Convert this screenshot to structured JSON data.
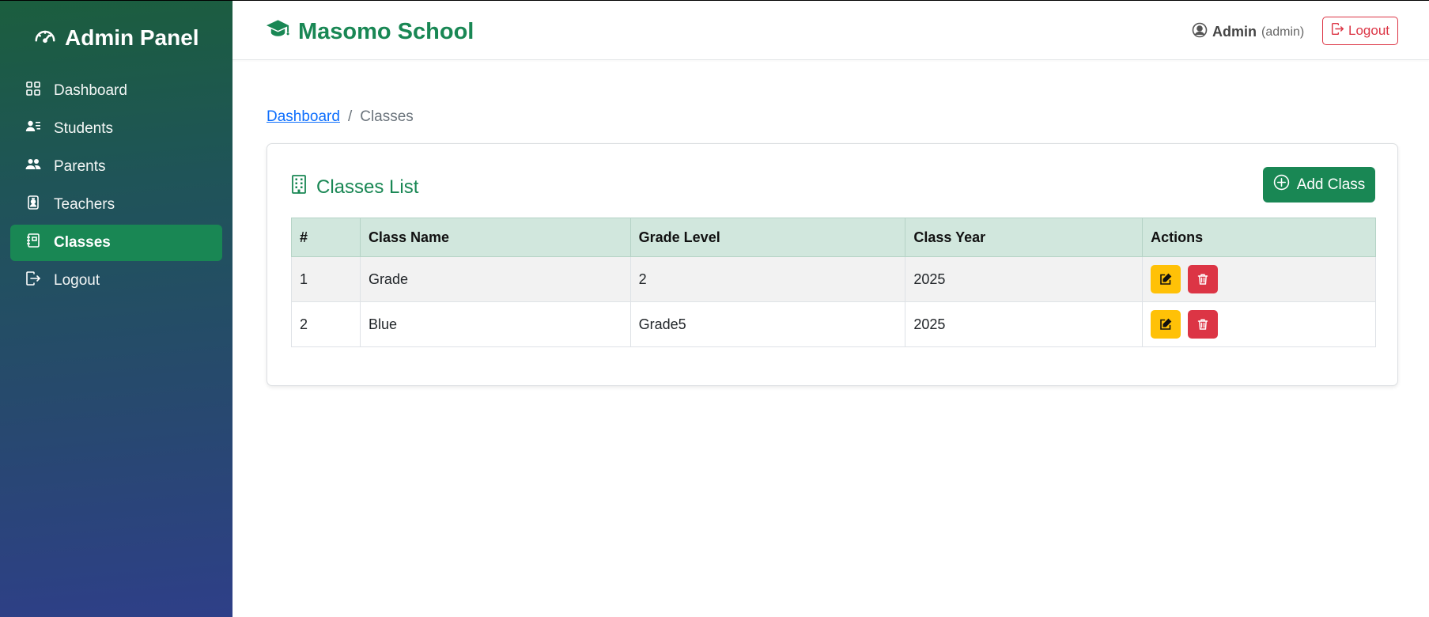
{
  "sidebar": {
    "brand": "Admin Panel",
    "items": [
      {
        "label": "Dashboard",
        "icon": "grid-icon",
        "active": false
      },
      {
        "label": "Students",
        "icon": "person-lines-icon",
        "active": false
      },
      {
        "label": "Parents",
        "icon": "people-icon",
        "active": false
      },
      {
        "label": "Teachers",
        "icon": "person-badge-icon",
        "active": false
      },
      {
        "label": "Classes",
        "icon": "journal-icon",
        "active": true
      },
      {
        "label": "Logout",
        "icon": "box-arrow-right-icon",
        "active": false
      }
    ]
  },
  "header": {
    "school_name": "Masomo School",
    "user_name": "Admin",
    "user_role": "(admin)",
    "logout_label": "Logout"
  },
  "breadcrumb": {
    "link": "Dashboard",
    "separator": "/",
    "current": "Classes"
  },
  "card": {
    "title": "Classes List",
    "add_label": "Add Class"
  },
  "table": {
    "columns": [
      "#",
      "Class Name",
      "Grade Level",
      "Class Year",
      "Actions"
    ],
    "rows": [
      {
        "num": "1",
        "name": "Grade",
        "grade": "2",
        "year": "2025"
      },
      {
        "num": "2",
        "name": "Blue",
        "grade": "Grade5",
        "year": "2025"
      }
    ]
  },
  "colors": {
    "primary_green": "#198754",
    "danger": "#dc3545",
    "warning": "#ffc107",
    "link": "#0d6efd"
  }
}
